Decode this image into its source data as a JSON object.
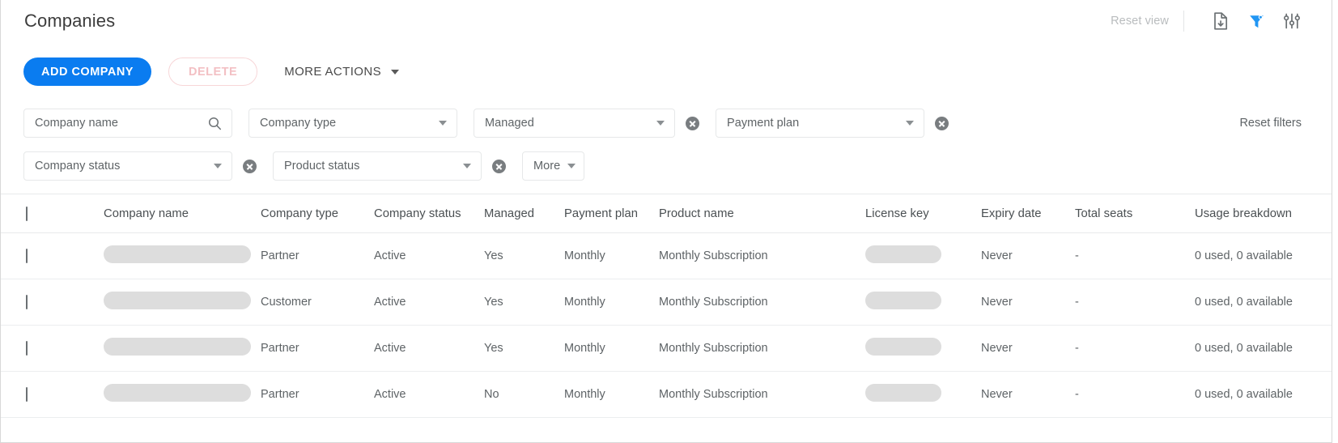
{
  "header": {
    "title": "Companies",
    "reset_view_label": "Reset view",
    "icons": [
      {
        "name": "export-file-icon",
        "title": "Export"
      },
      {
        "name": "filter-funnel-icon",
        "title": "Filter",
        "color": "#2196f3"
      },
      {
        "name": "column-settings-icon",
        "title": "Settings"
      }
    ]
  },
  "actions": {
    "add_label": "ADD COMPANY",
    "delete_label": "DELETE",
    "more_actions_label": "MORE ACTIONS"
  },
  "filters": {
    "reset_filters_label": "Reset filters",
    "row1": [
      {
        "label": "Company name",
        "control": "search",
        "clearable": false
      },
      {
        "label": "Company type",
        "control": "select",
        "clearable": false
      },
      {
        "label": "Managed",
        "control": "select",
        "clearable": true
      },
      {
        "label": "Payment plan",
        "control": "select",
        "clearable": true
      }
    ],
    "row2": [
      {
        "label": "Company status",
        "control": "select",
        "clearable": true
      },
      {
        "label": "Product status",
        "control": "select",
        "clearable": true
      },
      {
        "label": "More",
        "control": "select",
        "clearable": false
      }
    ]
  },
  "table": {
    "columns": [
      "Company name",
      "Company type",
      "Company status",
      "Managed",
      "Payment plan",
      "Product name",
      "License key",
      "Expiry date",
      "Total seats",
      "Usage breakdown"
    ],
    "rows": [
      {
        "company_name": "",
        "company_type": "Partner",
        "company_status": "Active",
        "managed": "Yes",
        "payment_plan": "Monthly",
        "product_name": "Monthly Subscription",
        "license_key": "",
        "expiry_date": "Never",
        "total_seats": "-",
        "usage_breakdown": "0 used, 0 available"
      },
      {
        "company_name": "",
        "company_type": "Customer",
        "company_status": "Active",
        "managed": "Yes",
        "payment_plan": "Monthly",
        "product_name": "Monthly Subscription",
        "license_key": "",
        "expiry_date": "Never",
        "total_seats": "-",
        "usage_breakdown": "0 used, 0 available"
      },
      {
        "company_name": "",
        "company_type": "Partner",
        "company_status": "Active",
        "managed": "Yes",
        "payment_plan": "Monthly",
        "product_name": "Monthly Subscription",
        "license_key": "",
        "expiry_date": "Never",
        "total_seats": "-",
        "usage_breakdown": "0 used, 0 available"
      },
      {
        "company_name": "",
        "company_type": "Partner",
        "company_status": "Active",
        "managed": "No",
        "payment_plan": "Monthly",
        "product_name": "Monthly Subscription",
        "license_key": "",
        "expiry_date": "Never",
        "total_seats": "-",
        "usage_breakdown": "0 used, 0 available"
      }
    ]
  },
  "colors": {
    "primary": "#0a7cf0",
    "filter_active": "#2196f3",
    "text": "#5e6366",
    "muted": "#b9bcbe"
  }
}
